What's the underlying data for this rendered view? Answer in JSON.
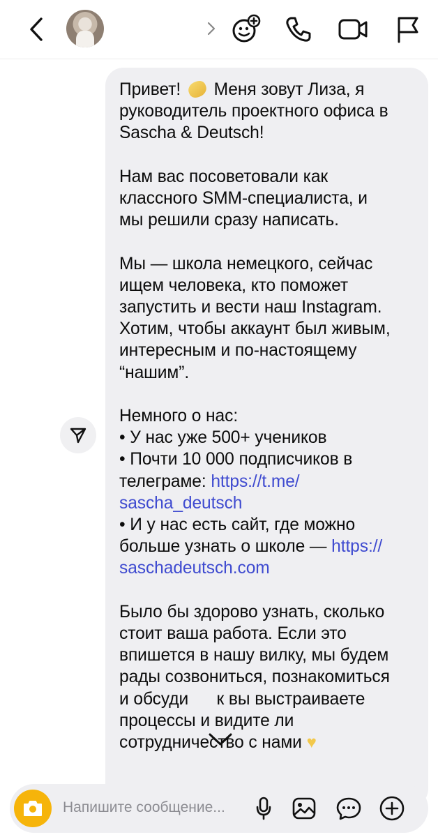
{
  "header": {
    "back_icon": "chevron-left-icon",
    "avatar": "contact-avatar",
    "expand_icon": "chevron-right-icon",
    "actions": [
      "effects-icon",
      "phone-icon",
      "video-camera-icon",
      "flag-icon"
    ]
  },
  "message": {
    "p1": [
      "Привет! ",
      " Меня зовут Лиза, я",
      "руководитель проектного офиса в",
      "Sascha & Deutsch!"
    ],
    "p2": [
      "Нам вас посоветовали как",
      "классного SMM-специалиста, и",
      "мы решили сразу написать."
    ],
    "p3": [
      "Мы — школа немецкого, сейчас",
      "ищем человека, кто поможет",
      "запустить и вести наш Instagram.",
      "Хотим, чтобы аккаунт был живым,",
      "интересным и по-настоящему",
      "“нашим”."
    ],
    "p4_title": "Немного о нас:",
    "p4_b1": "• У нас уже 500+ учеников",
    "p4_b2a": "• Почти 10 000 подписчиков в",
    "p4_b2b": "телеграме: ",
    "p4_link1a": "https://t.me/",
    "p4_link1b": "sascha_deutsch",
    "p4_b3a": "• И у нас есть сайт, где можно",
    "p4_b3b": "больше узнать о школе — ",
    "p4_link2a": "https://",
    "p4_link2b": "saschadeutsch.com",
    "p5": [
      "Было бы здорово узнать, сколько",
      "стоит ваша работа. Если это",
      "впишется в нашу вилку, мы будем",
      "рады созвониться, познакомиться",
      "и обсуди      к вы выстраиваете",
      "процессы и видите ли",
      "сотрудничество с нами "
    ],
    "emoji_sparkle": "sparkle-star-emoji",
    "emoji_heart": "♥"
  },
  "composer": {
    "placeholder": "Напишите сообщение...",
    "icons": [
      "camera-icon",
      "microphone-icon",
      "gallery-icon",
      "sticker-icon",
      "add-icon"
    ]
  },
  "colors": {
    "bubble": "#efeff2",
    "link": "#3f4bd0",
    "camera_button": "#f6b40a"
  }
}
